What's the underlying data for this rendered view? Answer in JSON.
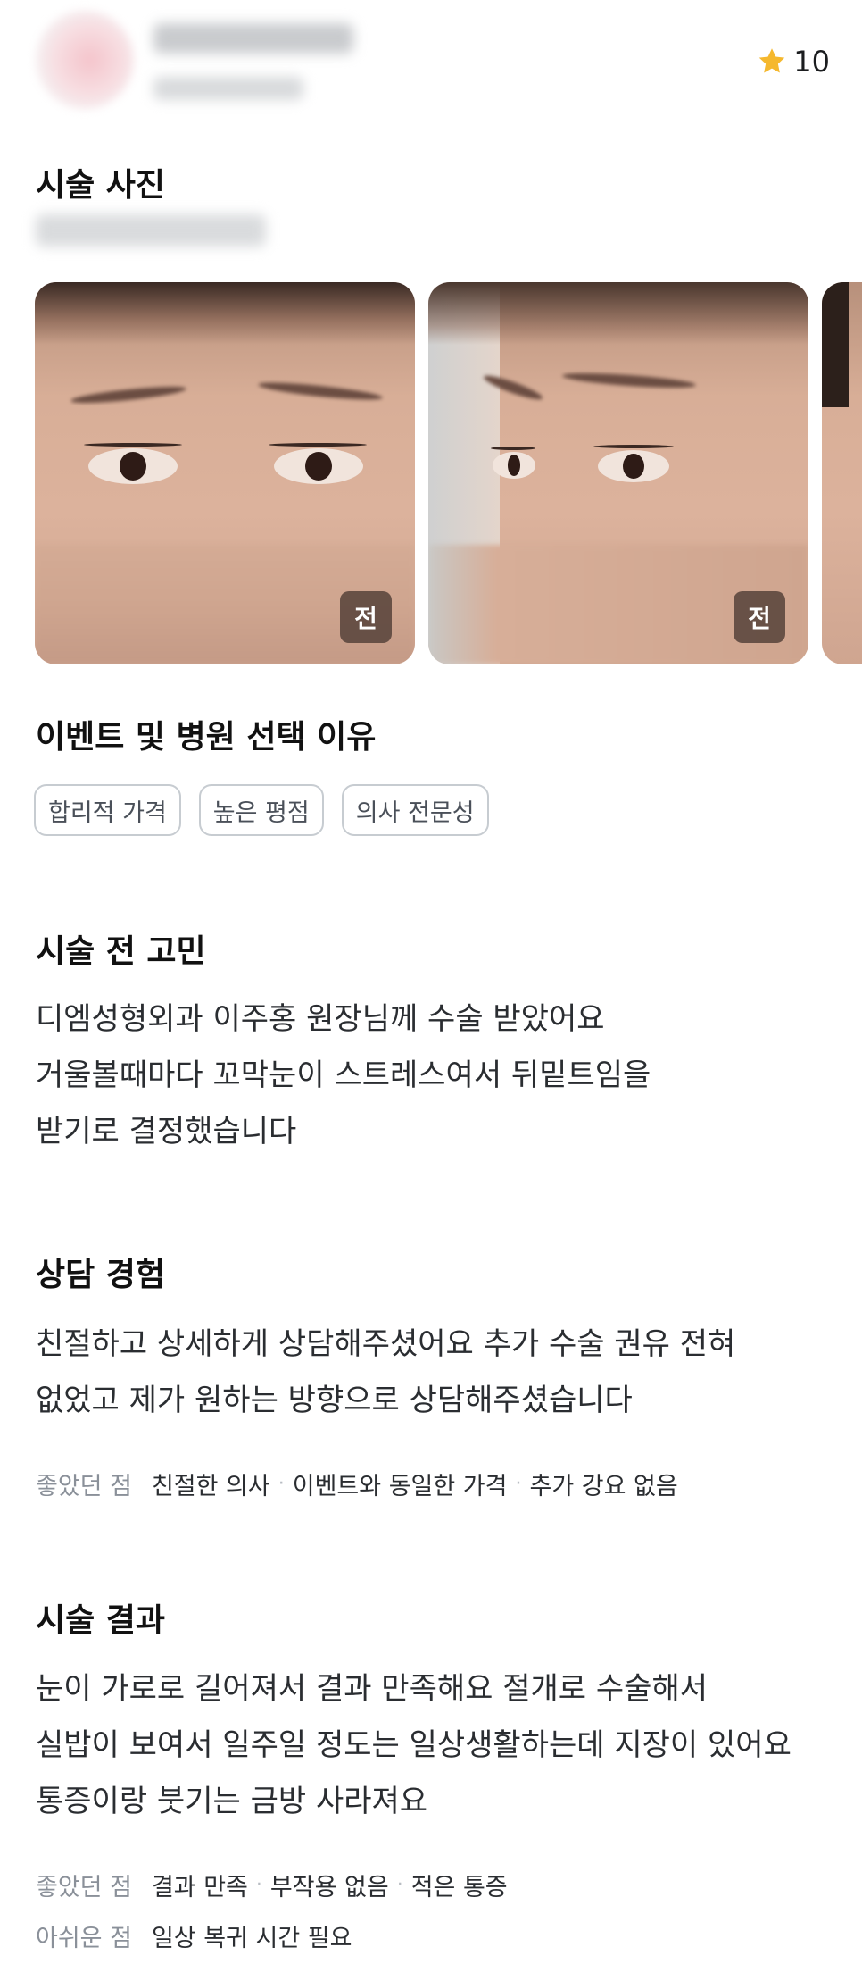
{
  "header": {
    "rating": "10"
  },
  "photos_section": {
    "title": "시술 사진",
    "photos": [
      {
        "badge": "전"
      },
      {
        "badge": "전"
      }
    ]
  },
  "reason_section": {
    "title": "이벤트 및 병원 선택 이유",
    "chips": [
      "합리적 가격",
      "높은 평점",
      "의사 전문성"
    ]
  },
  "before_section": {
    "title": "시술 전 고민",
    "lines": [
      "디엠성형외과 이주홍 원장님께 수술 받았어요",
      "거울볼때마다 꼬막눈이 스트레스여서 뒤밑트임을",
      "받기로 결정했습니다"
    ]
  },
  "consult_section": {
    "title": "상담 경험",
    "lines": [
      "친절하고 상세하게 상담해주셨어요 추가 수술 권유 전혀",
      "없었고 제가 원하는 방향으로 상담해주셨습니다"
    ],
    "good_label": "좋았던 점",
    "good_items": [
      "친절한 의사",
      "이벤트와 동일한 가격",
      "추가 강요 없음"
    ]
  },
  "result_section": {
    "title": "시술 결과",
    "lines": [
      "눈이 가로로 길어져서 결과 만족해요 절개로 수술해서",
      "실밥이 보여서 일주일 정도는 일상생활하는데 지장이 있어요",
      "통증이랑 붓기는 금방 사라져요"
    ],
    "good_label": "좋았던 점",
    "good_items": [
      "결과 만족",
      "부작용 없음",
      "적은 통증"
    ],
    "bad_label": "아쉬운 점",
    "bad_items": [
      "일상 복귀 시간 필요"
    ]
  },
  "icons": {
    "rating": "star-icon"
  },
  "colors": {
    "star": "#f5b82e",
    "chip_border": "#c7ccd1",
    "muted_label": "#8a9099"
  }
}
